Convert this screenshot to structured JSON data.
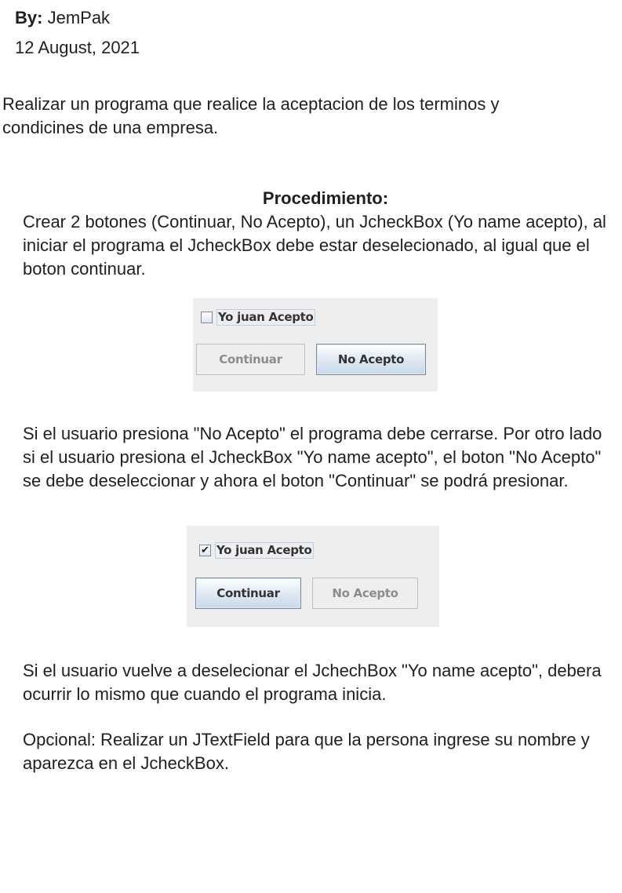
{
  "header": {
    "by_label": "By:",
    "author": "JemPak",
    "date": "12 August, 2021"
  },
  "intro": "Realizar un programa que realice la aceptacion de los terminos y condicines de una empresa.",
  "procedure": {
    "title": "Procedimiento:",
    "step1": "Crear 2 botones (Continuar, No Acepto), un JcheckBox (Yo name acepto), al iniciar el programa el JcheckBox debe estar deselecionado, al igual que el boton continuar.",
    "step2": "Si el usuario presiona \"No Acepto\" el programa debe cerrarse. Por otro lado si el usuario presiona el JcheckBox \"Yo name acepto\", el boton \"No Acepto\" se debe deseleccionar y ahora el boton \"Continuar\" se podrá presionar.",
    "step3": "Si el usuario vuelve a deselecionar el JchechBox \"Yo name acepto\", debera ocurrir lo mismo que cuando el programa inicia.",
    "optional": "Opcional: Realizar un JTextField para que la persona ingrese su nombre y aparezca en el JcheckBox."
  },
  "screenshot_unchecked": {
    "checkbox_label": "Yo juan Acepto",
    "checkbox_mark": "",
    "continue_label": "Continuar",
    "no_accept_label": "No Acepto"
  },
  "screenshot_checked": {
    "checkbox_label": "Yo juan Acepto",
    "checkbox_mark": "✔",
    "continue_label": "Continuar",
    "no_accept_label": "No Acepto"
  }
}
